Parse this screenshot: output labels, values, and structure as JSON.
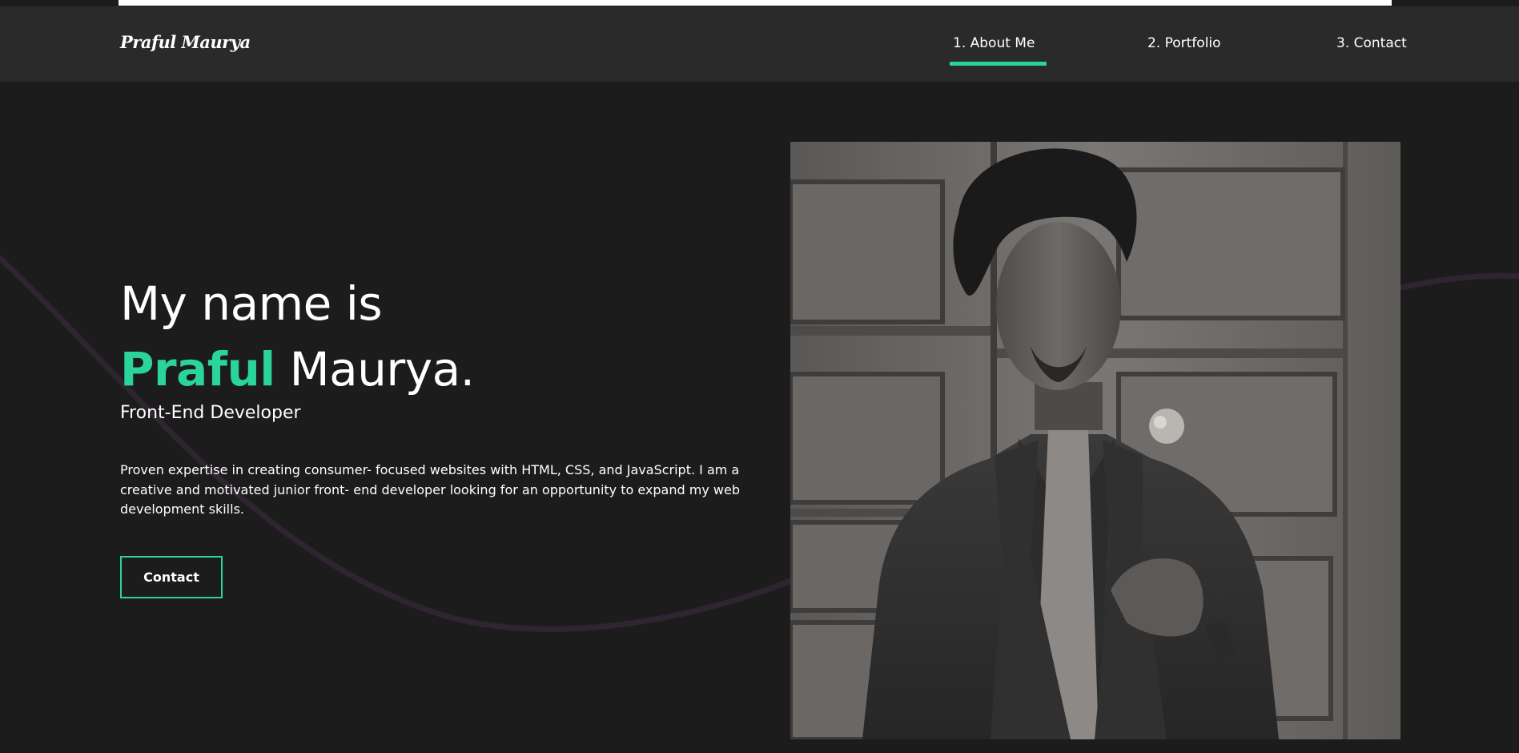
{
  "nav": {
    "logo": "Praful Maurya",
    "links": [
      "1. About Me",
      "2. Portfolio",
      "3. Contact"
    ],
    "active_index": 0
  },
  "hero": {
    "greeting": "My name is",
    "first_name": "Praful",
    "last_name": " Maurya.",
    "role": "Front-End Developer",
    "bio": "Proven expertise in creating consumer- focused websites with HTML, CSS, and JavaScript. I am a creative and motivated junior front- end developer looking for an opportunity to expand my web development skills.",
    "contact_button": "Contact"
  },
  "photo": {
    "subject": "black-and-white portrait of a man in a suit and tie standing before a wooden paneled door"
  },
  "colors": {
    "background": "#1c1c1d",
    "navbar": "#2a2a2b",
    "accent": "#2ad49a",
    "curve": "#2e2530"
  }
}
